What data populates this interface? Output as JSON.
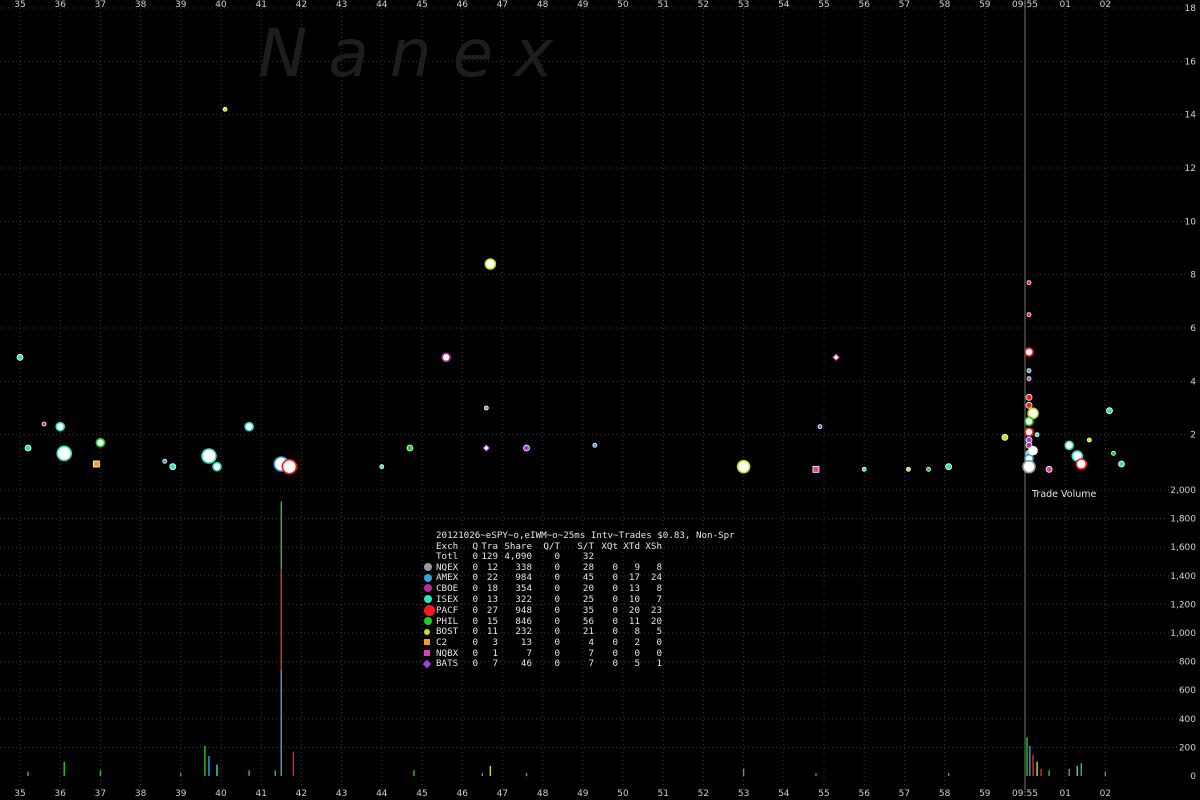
{
  "watermark": "N  a  n  e  x",
  "legend": {
    "title": "20121026~eSPY~o,eIWM~o~25ms Intv~Trades $0.83, Non-Spr",
    "header": [
      "Exch",
      "Q",
      "Tra",
      "Share",
      "Q/T",
      "S/T",
      "XQt",
      "XTd",
      "XSh"
    ],
    "rows": [
      {
        "exch": "Totl",
        "swatch": "",
        "shape": "none",
        "q": "0",
        "tra": "129",
        "share": "4,090",
        "qt": "0",
        "st": "32",
        "xqt": "",
        "xtd": "",
        "xsh": ""
      },
      {
        "exch": "NQEX",
        "swatch": "#9a9a9a",
        "shape": "circle",
        "q": "0",
        "tra": "12",
        "share": "338",
        "qt": "0",
        "st": "28",
        "xqt": "0",
        "xtd": "9",
        "xsh": "8"
      },
      {
        "exch": "AMEX",
        "swatch": "#3aa0d8",
        "shape": "circle",
        "q": "0",
        "tra": "22",
        "share": "984",
        "qt": "0",
        "st": "45",
        "xqt": "0",
        "xtd": "17",
        "xsh": "24"
      },
      {
        "exch": "CBOE",
        "swatch": "#b0309a",
        "shape": "circle",
        "q": "0",
        "tra": "18",
        "share": "354",
        "qt": "0",
        "st": "20",
        "xqt": "0",
        "xtd": "13",
        "xsh": "8"
      },
      {
        "exch": "ISEX",
        "swatch": "#33e0c0",
        "shape": "circle",
        "q": "0",
        "tra": "13",
        "share": "322",
        "qt": "0",
        "st": "25",
        "xqt": "0",
        "xtd": "10",
        "xsh": "7"
      },
      {
        "exch": "PACF",
        "swatch": "#ff1a1a",
        "shape": "circle-big",
        "q": "0",
        "tra": "27",
        "share": "948",
        "qt": "0",
        "st": "35",
        "xqt": "0",
        "xtd": "20",
        "xsh": "23"
      },
      {
        "exch": "PHIL",
        "swatch": "#22cc22",
        "shape": "circle",
        "q": "0",
        "tra": "15",
        "share": "846",
        "qt": "0",
        "st": "56",
        "xqt": "0",
        "xtd": "11",
        "xsh": "20"
      },
      {
        "exch": "BOST",
        "swatch": "#c8e020",
        "shape": "circle-small",
        "q": "0",
        "tra": "11",
        "share": "232",
        "qt": "0",
        "st": "21",
        "xqt": "0",
        "xtd": "8",
        "xsh": "5"
      },
      {
        "exch": "C2",
        "swatch": "#f0a020",
        "shape": "square",
        "q": "0",
        "tra": "3",
        "share": "13",
        "qt": "0",
        "st": "4",
        "xqt": "0",
        "xtd": "2",
        "xsh": "0"
      },
      {
        "exch": "NQBX",
        "swatch": "#e040b0",
        "shape": "square",
        "q": "0",
        "tra": "1",
        "share": "7",
        "qt": "0",
        "st": "7",
        "xqt": "0",
        "xtd": "0",
        "xsh": "0"
      },
      {
        "exch": "BATS",
        "swatch": "#a040e0",
        "shape": "diamond",
        "q": "0",
        "tra": "7",
        "share": "46",
        "qt": "0",
        "st": "7",
        "xqt": "0",
        "xtd": "5",
        "xsh": "1"
      }
    ]
  },
  "volume_label": "Trade Volume",
  "chart_data": {
    "type": "scatter",
    "x_tick_labels": [
      "35",
      "36",
      "37",
      "38",
      "39",
      "40",
      "41",
      "42",
      "43",
      "44",
      "45",
      "46",
      "47",
      "48",
      "49",
      "50",
      "51",
      "52",
      "53",
      "54",
      "55",
      "56",
      "57",
      "58",
      "59",
      "09:55",
      "01",
      "02"
    ],
    "top_panel": {
      "y_ticks": [
        "2",
        "4",
        "6",
        "8",
        "10",
        "12",
        "14",
        "16",
        "18"
      ],
      "ylim": [
        0,
        18
      ],
      "points": [
        {
          "x": 35.0,
          "y": 4.9,
          "color": "#33e0c0",
          "size": 3
        },
        {
          "x": 35.2,
          "y": 1.5,
          "color": "#33e0c0",
          "size": 3
        },
        {
          "x": 35.6,
          "y": 2.4,
          "color": "#b0309a",
          "size": 2
        },
        {
          "x": 36.0,
          "y": 2.3,
          "color": "#33e0c0",
          "size": 4
        },
        {
          "x": 36.1,
          "y": 1.3,
          "color": "#33e0c0",
          "size": 7
        },
        {
          "x": 36.9,
          "y": 0.9,
          "color": "#f0a020",
          "size": 3,
          "shape": "square"
        },
        {
          "x": 37.0,
          "y": 1.7,
          "color": "#22cc22",
          "size": 4
        },
        {
          "x": 38.6,
          "y": 1.0,
          "color": "#3aa0d8",
          "size": 2
        },
        {
          "x": 38.8,
          "y": 0.8,
          "color": "#33e0c0",
          "size": 3
        },
        {
          "x": 39.7,
          "y": 1.2,
          "color": "#33e0c0",
          "size": 7
        },
        {
          "x": 39.9,
          "y": 0.8,
          "color": "#33e0c0",
          "size": 4
        },
        {
          "x": 40.1,
          "y": 14.2,
          "color": "#c8e020",
          "size": 2
        },
        {
          "x": 40.7,
          "y": 2.3,
          "color": "#33e0c0",
          "size": 4
        },
        {
          "x": 41.5,
          "y": 0.9,
          "color": "#3aa0d8",
          "size": 7
        },
        {
          "x": 41.7,
          "y": 0.8,
          "color": "#ff1a1a",
          "size": 7
        },
        {
          "x": 44.0,
          "y": 0.8,
          "color": "#33e0c0",
          "size": 2
        },
        {
          "x": 44.7,
          "y": 1.5,
          "color": "#22cc22",
          "size": 3
        },
        {
          "x": 45.6,
          "y": 4.9,
          "color": "#b0309a",
          "size": 4
        },
        {
          "x": 46.6,
          "y": 3.0,
          "color": "#9a9a9a",
          "size": 2
        },
        {
          "x": 46.6,
          "y": 1.5,
          "color": "#a040e0",
          "size": 3,
          "shape": "diamond"
        },
        {
          "x": 46.7,
          "y": 8.4,
          "color": "#c8e020",
          "size": 5
        },
        {
          "x": 47.6,
          "y": 1.5,
          "color": "#a040e0",
          "size": 3
        },
        {
          "x": 49.3,
          "y": 1.6,
          "color": "#3aa0d8",
          "size": 2
        },
        {
          "x": 53.0,
          "y": 0.8,
          "color": "#c8e020",
          "size": 6
        },
        {
          "x": 54.8,
          "y": 0.7,
          "color": "#e040b0",
          "size": 3,
          "shape": "square"
        },
        {
          "x": 54.9,
          "y": 2.3,
          "color": "#a040e0",
          "size": 2
        },
        {
          "x": 55.3,
          "y": 4.9,
          "color": "#e040b0",
          "size": 3,
          "shape": "diamond"
        },
        {
          "x": 56.0,
          "y": 0.7,
          "color": "#33e0c0",
          "size": 2
        },
        {
          "x": 57.1,
          "y": 0.7,
          "color": "#c8e020",
          "size": 2
        },
        {
          "x": 57.6,
          "y": 0.7,
          "color": "#22cc22",
          "size": 2
        },
        {
          "x": 58.1,
          "y": 0.8,
          "color": "#33e0c0",
          "size": 3
        },
        {
          "x": 59.5,
          "y": 1.9,
          "color": "#c8e020",
          "size": 3
        },
        {
          "x": 60.1,
          "y": 7.7,
          "color": "#ff1a1a",
          "size": 2
        },
        {
          "x": 60.1,
          "y": 6.5,
          "color": "#ff1a1a",
          "size": 2
        },
        {
          "x": 60.1,
          "y": 5.1,
          "color": "#ff1a1a",
          "size": 4
        },
        {
          "x": 60.1,
          "y": 4.4,
          "color": "#3aa0d8",
          "size": 2
        },
        {
          "x": 60.1,
          "y": 4.1,
          "color": "#a040e0",
          "size": 2
        },
        {
          "x": 60.1,
          "y": 3.4,
          "color": "#ff1a1a",
          "size": 3
        },
        {
          "x": 60.1,
          "y": 3.1,
          "color": "#ff1a1a",
          "size": 3
        },
        {
          "x": 60.2,
          "y": 2.8,
          "color": "#c8e020",
          "size": 5
        },
        {
          "x": 60.1,
          "y": 2.5,
          "color": "#22cc22",
          "size": 4
        },
        {
          "x": 60.1,
          "y": 2.1,
          "color": "#ff1a1a",
          "size": 4
        },
        {
          "x": 60.1,
          "y": 1.8,
          "color": "#a040e0",
          "size": 3
        },
        {
          "x": 60.1,
          "y": 1.6,
          "color": "#b0309a",
          "size": 3
        },
        {
          "x": 60.1,
          "y": 1.3,
          "color": "#33e0c0",
          "size": 3
        },
        {
          "x": 60.1,
          "y": 1.1,
          "color": "#3aa0d8",
          "size": 4
        },
        {
          "x": 60.1,
          "y": 0.8,
          "color": "#9a9a9a",
          "size": 6
        },
        {
          "x": 60.2,
          "y": 1.4,
          "color": "#ffffff",
          "size": 4
        },
        {
          "x": 60.3,
          "y": 2.0,
          "color": "#33e0c0",
          "size": 2
        },
        {
          "x": 60.6,
          "y": 0.7,
          "color": "#e040b0",
          "size": 3
        },
        {
          "x": 61.1,
          "y": 1.6,
          "color": "#33e0c0",
          "size": 4
        },
        {
          "x": 61.3,
          "y": 1.2,
          "color": "#33e0c0",
          "size": 5
        },
        {
          "x": 61.4,
          "y": 0.9,
          "color": "#ff1a1a",
          "size": 5
        },
        {
          "x": 61.6,
          "y": 1.8,
          "color": "#c8e020",
          "size": 2
        },
        {
          "x": 62.1,
          "y": 2.9,
          "color": "#33e0c0",
          "size": 3
        },
        {
          "x": 62.2,
          "y": 1.3,
          "color": "#22cc22",
          "size": 2
        },
        {
          "x": 62.4,
          "y": 0.9,
          "color": "#33e0c0",
          "size": 3
        }
      ]
    },
    "bottom_panel": {
      "title": "Trade Volume",
      "y_ticks": [
        "200",
        "400",
        "600",
        "800",
        "1,000",
        "1,200",
        "1,400",
        "1,600",
        "1,800",
        "2,000"
      ],
      "ylim": [
        0,
        2000
      ],
      "bars": [
        {
          "x": 35.2,
          "v": 30,
          "color": "#22cc22"
        },
        {
          "x": 36.1,
          "v": 100,
          "color": "#22cc22"
        },
        {
          "x": 37.0,
          "v": 40,
          "color": "#22cc22"
        },
        {
          "x": 39.0,
          "v": 20,
          "color": "#22cc22"
        },
        {
          "x": 39.6,
          "v": 210,
          "color": "#22cc22"
        },
        {
          "x": 39.7,
          "v": 140,
          "color": "#3aa0d8"
        },
        {
          "x": 39.9,
          "v": 80,
          "color": "#33e0c0"
        },
        {
          "x": 40.7,
          "v": 40,
          "color": "#22cc22"
        },
        {
          "x": 41.5,
          "v": 1920,
          "color": "#22cc22"
        },
        {
          "x": 41.5,
          "v": 1450,
          "color": "#ff1a1a"
        },
        {
          "x": 41.5,
          "v": 740,
          "color": "#3aa0d8"
        },
        {
          "x": 41.8,
          "v": 170,
          "color": "#ff1a1a"
        },
        {
          "x": 41.35,
          "v": 40,
          "color": "#22cc22"
        },
        {
          "x": 44.8,
          "v": 40,
          "color": "#22cc22"
        },
        {
          "x": 46.5,
          "v": 20,
          "color": "#22cc22"
        },
        {
          "x": 46.7,
          "v": 70,
          "color": "#c8e020"
        },
        {
          "x": 47.6,
          "v": 20,
          "color": "#22cc22"
        },
        {
          "x": 53.0,
          "v": 50,
          "color": "#22cc22"
        },
        {
          "x": 54.8,
          "v": 20,
          "color": "#e040b0"
        },
        {
          "x": 58.1,
          "v": 20,
          "color": "#22cc22"
        },
        {
          "x": 60.05,
          "v": 270,
          "color": "#22cc22"
        },
        {
          "x": 60.12,
          "v": 210,
          "color": "#3aa0d8"
        },
        {
          "x": 60.2,
          "v": 150,
          "color": "#ff1a1a"
        },
        {
          "x": 60.3,
          "v": 100,
          "color": "#c8e020"
        },
        {
          "x": 60.4,
          "v": 50,
          "color": "#ff1a1a"
        },
        {
          "x": 60.6,
          "v": 40,
          "color": "#22cc22"
        },
        {
          "x": 61.1,
          "v": 50,
          "color": "#22cc22"
        },
        {
          "x": 61.3,
          "v": 70,
          "color": "#33e0c0"
        },
        {
          "x": 61.4,
          "v": 90,
          "color": "#22cc22"
        },
        {
          "x": 62.0,
          "v": 30,
          "color": "#22cc22"
        }
      ]
    }
  }
}
